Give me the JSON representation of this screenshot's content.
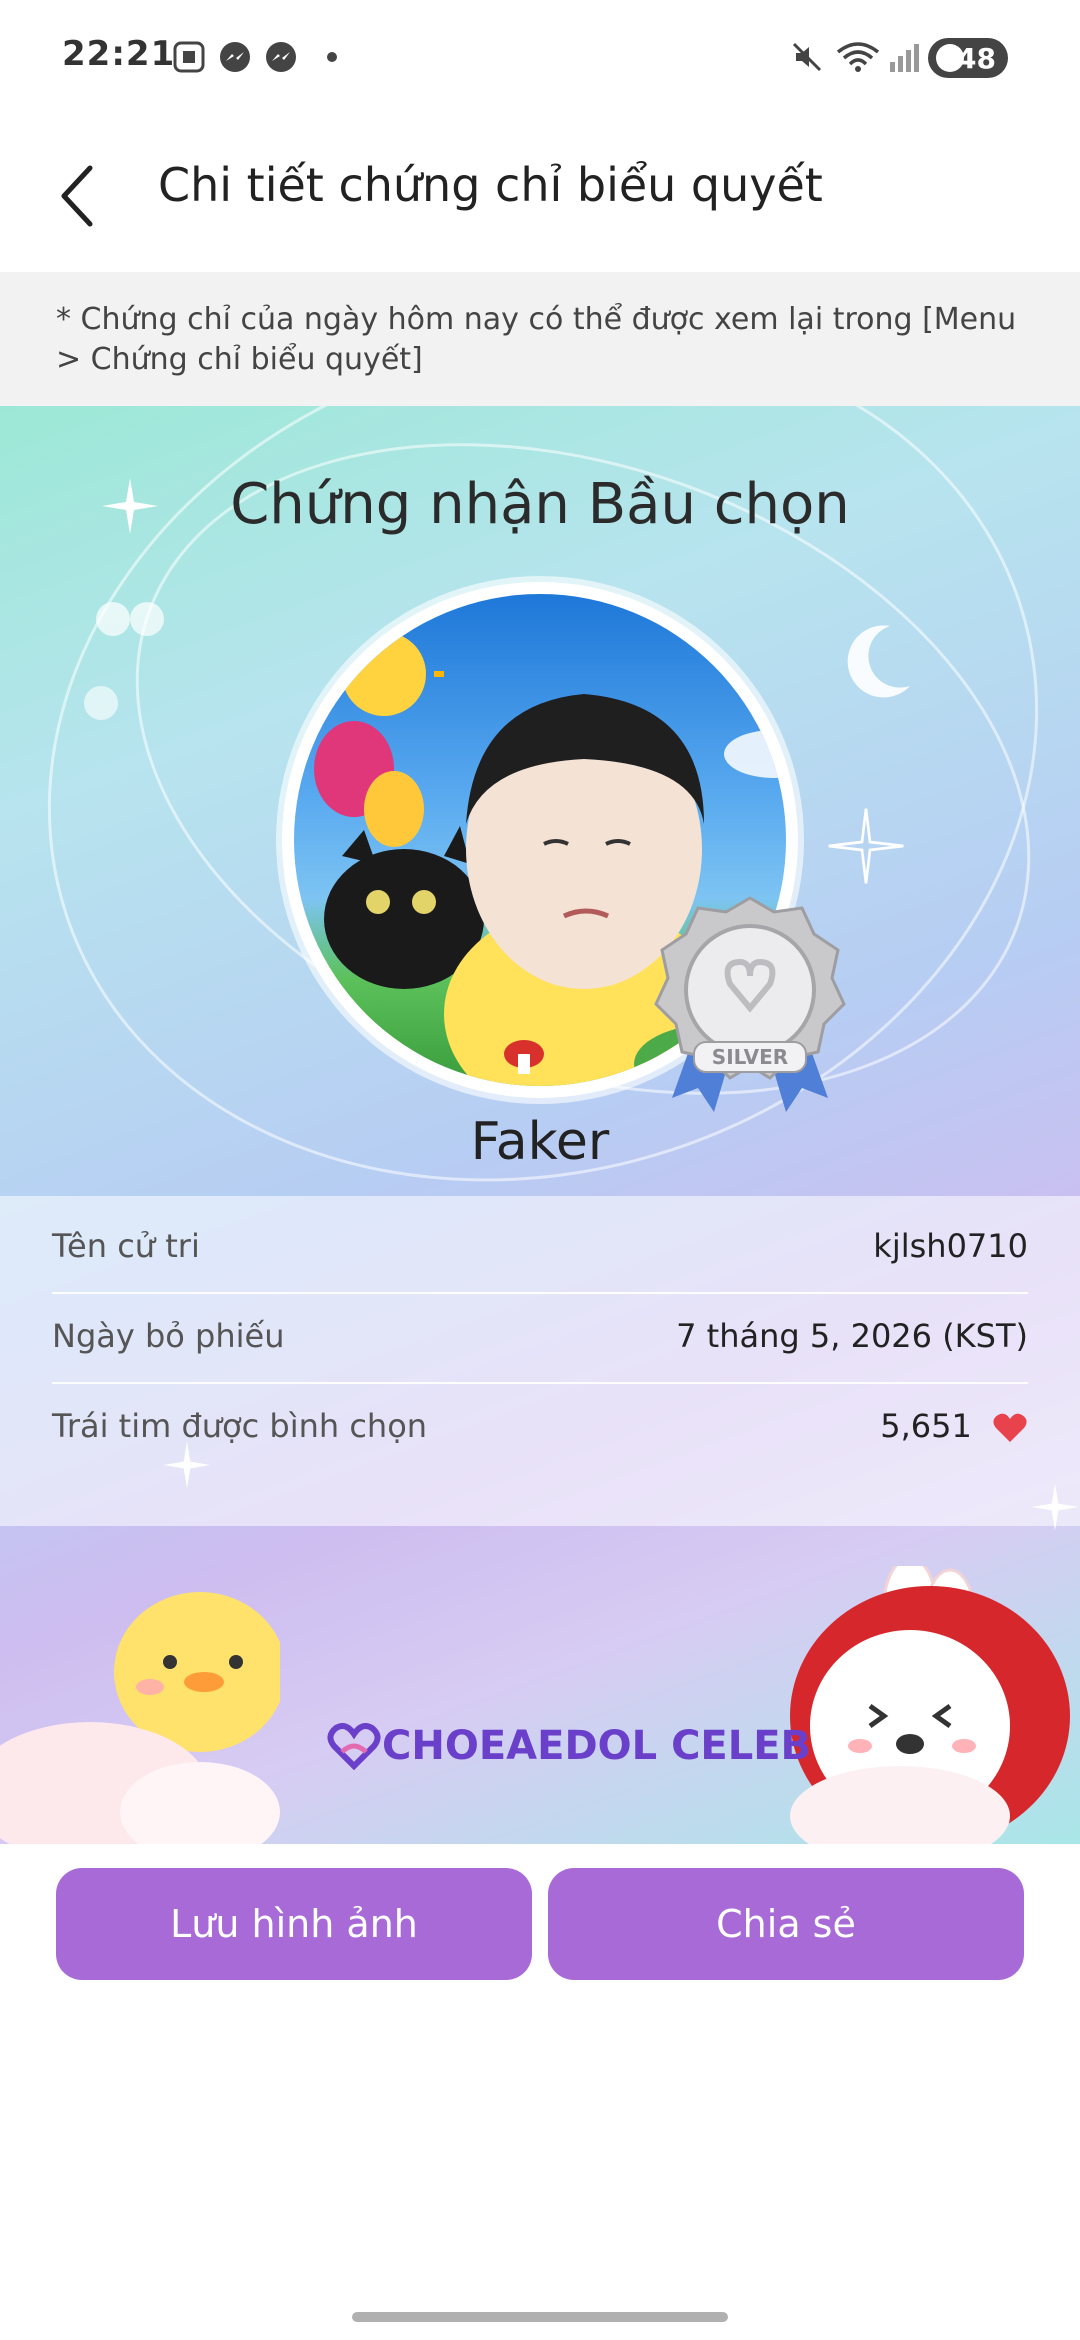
{
  "status_bar": {
    "time": "22:21",
    "battery": "48",
    "icons": [
      "screenshot-icon",
      "messenger-icon",
      "messenger-icon",
      "dot-icon",
      "mute-icon",
      "wifi-icon",
      "signal-icon",
      "battery-icon"
    ]
  },
  "header": {
    "back_icon": "chevron-left-icon",
    "title": "Chi tiết chứng chỉ biểu quyết"
  },
  "notice": {
    "text": "* Chứng chỉ của ngày hôm nay có thể được xem lại trong [Menu > Chứng chỉ biểu quyết]"
  },
  "certificate": {
    "title": "Chứng nhận Bầu chọn",
    "badge_label": "SILVER",
    "name": "Faker",
    "rows": [
      {
        "label": "Tên cử tri",
        "value": "kjlsh0710"
      },
      {
        "label": "Ngày bỏ phiếu",
        "value": "7 tháng 5, 2026 (KST)"
      },
      {
        "label": "Trái tim được bình chọn",
        "value": "5,651"
      }
    ],
    "brand": "CHOEAEDOL CELEB"
  },
  "actions": {
    "save_label": "Lưu hình ảnh",
    "share_label": "Chia sẻ"
  },
  "colors": {
    "accent": "#a86ad6",
    "brand": "#6a3fc9",
    "heart": "#e8424c"
  }
}
